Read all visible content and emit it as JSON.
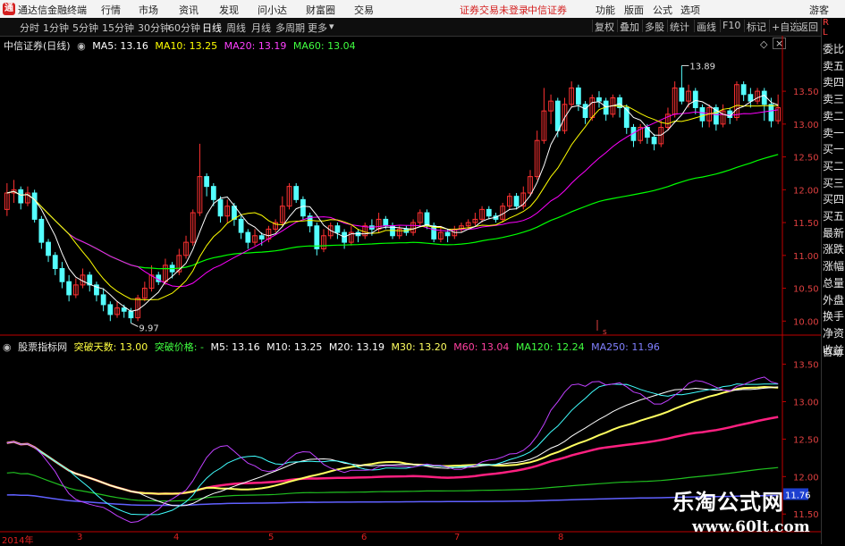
{
  "titlebar": {
    "logo_glyph": "通",
    "app_name": "通达信金融终端",
    "menus": [
      "行情",
      "市场",
      "资讯",
      "发现",
      "问小达",
      "财富圈",
      "交易"
    ],
    "alerts": [
      "证券交易未登录",
      "中信证券"
    ],
    "right_menus": [
      "功能",
      "版面",
      "公式",
      "选项"
    ],
    "guest": "游客"
  },
  "toolbar": {
    "periods": [
      "分时",
      "1分钟",
      "5分钟",
      "15分钟",
      "30分钟",
      "60分钟",
      "日线",
      "周线",
      "月线",
      "多周期",
      "更多"
    ],
    "active_period": "日线",
    "right_buttons": [
      "复权",
      "叠加",
      "多股",
      "统计",
      "画线",
      "F10",
      "标记",
      "+自选",
      "返回"
    ]
  },
  "main_info": {
    "stock": "中信证券(日线)",
    "ma5": "MA5: 13.16",
    "ma10": "MA10: 13.25",
    "ma20": "MA20: 13.19",
    "ma60": "MA60: 13.04"
  },
  "indicator_info": {
    "name": "股票指标网",
    "days": "突破天数: 13.00",
    "price": "突破价格: -",
    "m5": "M5: 13.16",
    "m10": "M10: 13.25",
    "m20": "M20: 13.19",
    "m30": "M30: 13.20",
    "m60": "M60: 13.04",
    "ma120": "MA120: 12.24",
    "ma250": "MA250: 11.96"
  },
  "right_column": {
    "top_label": "R",
    "top_label2": "L",
    "items": [
      "委比",
      "卖五",
      "卖四",
      "卖三",
      "卖二",
      "卖一",
      "买一",
      "买二",
      "买三",
      "买四",
      "买五",
      "最新",
      "涨跌",
      "涨幅",
      "总量",
      "外盘",
      "换手",
      "净资",
      "收益"
    ],
    "bottom": "自动"
  },
  "main_axis": {
    "ticks": [
      "13.50",
      "13.00",
      "12.50",
      "12.00",
      "11.50",
      "11.00",
      "10.50",
      "10.00"
    ]
  },
  "indicator_axis": {
    "ticks": [
      "13.50",
      "13.00",
      "12.50",
      "12.00",
      "11.50"
    ],
    "current_value": "11.76"
  },
  "annotations": {
    "high": "13.89",
    "low": "9.97",
    "marker_s": "s"
  },
  "date_axis": {
    "labels": [
      "2014年",
      "3",
      "4",
      "5",
      "6",
      "7",
      "8"
    ]
  },
  "watermark": {
    "title": "乐淘公式网",
    "url": "www.60lt.com"
  },
  "colors": {
    "up": "#ff3232",
    "down": "#54ffff",
    "ma5": "#ffffff",
    "ma10": "#ffff00",
    "ma20": "#ff00ff",
    "ma60": "#00ff00",
    "axis": "#c00000"
  },
  "chart_data": {
    "type": "candlestick",
    "title": "中信证券(日线)",
    "y_range": [
      9.8,
      14.1
    ],
    "candles": [
      [
        11.7,
        11.95,
        12.1,
        11.6
      ],
      [
        11.95,
        12.0,
        12.15,
        11.8
      ],
      [
        12.0,
        11.8,
        12.05,
        11.7
      ],
      [
        11.8,
        11.95,
        12.05,
        11.75
      ],
      [
        11.95,
        11.55,
        12.0,
        11.5
      ],
      [
        11.55,
        11.2,
        11.6,
        11.1
      ],
      [
        11.2,
        11.0,
        11.25,
        10.9
      ],
      [
        11.0,
        10.8,
        11.05,
        10.7
      ],
      [
        10.8,
        10.6,
        10.9,
        10.5
      ],
      [
        10.6,
        10.4,
        10.7,
        10.3
      ],
      [
        10.4,
        10.55,
        10.65,
        10.35
      ],
      [
        10.55,
        10.7,
        10.8,
        10.5
      ],
      [
        10.7,
        10.55,
        10.75,
        10.45
      ],
      [
        10.55,
        10.4,
        10.6,
        10.3
      ],
      [
        10.4,
        10.25,
        10.5,
        10.15
      ],
      [
        10.25,
        10.1,
        10.3,
        10.0
      ],
      [
        10.1,
        10.2,
        10.3,
        10.05
      ],
      [
        10.2,
        10.15,
        10.25,
        10.05
      ],
      [
        10.15,
        10.05,
        10.2,
        9.97
      ],
      [
        10.05,
        10.35,
        10.4,
        10.0
      ],
      [
        10.35,
        10.5,
        10.6,
        10.3
      ],
      [
        10.5,
        10.7,
        10.85,
        10.45
      ],
      [
        10.7,
        10.6,
        10.75,
        10.55
      ],
      [
        10.6,
        10.85,
        10.95,
        10.55
      ],
      [
        10.85,
        10.75,
        10.9,
        10.65
      ],
      [
        10.75,
        11.0,
        11.1,
        10.7
      ],
      [
        11.0,
        11.2,
        11.3,
        10.95
      ],
      [
        11.2,
        11.65,
        11.7,
        11.15
      ],
      [
        11.65,
        12.2,
        12.7,
        11.6
      ],
      [
        12.2,
        12.05,
        12.25,
        11.9
      ],
      [
        12.05,
        11.85,
        12.1,
        11.75
      ],
      [
        11.85,
        11.6,
        11.9,
        11.5
      ],
      [
        11.6,
        11.75,
        11.85,
        11.5
      ],
      [
        11.75,
        11.55,
        11.8,
        11.45
      ],
      [
        11.55,
        11.35,
        11.6,
        11.25
      ],
      [
        11.35,
        11.2,
        11.4,
        11.1
      ],
      [
        11.2,
        11.3,
        11.4,
        11.15
      ],
      [
        11.3,
        11.25,
        11.35,
        11.15
      ],
      [
        11.25,
        11.4,
        11.45,
        11.2
      ],
      [
        11.4,
        11.5,
        11.55,
        11.35
      ],
      [
        11.5,
        11.75,
        11.9,
        11.45
      ],
      [
        11.75,
        12.05,
        12.1,
        11.7
      ],
      [
        12.05,
        11.85,
        12.1,
        11.8
      ],
      [
        11.85,
        11.6,
        11.9,
        11.55
      ],
      [
        11.6,
        11.45,
        11.65,
        11.35
      ],
      [
        11.45,
        11.1,
        11.5,
        11.0
      ],
      [
        11.1,
        11.3,
        11.4,
        11.05
      ],
      [
        11.3,
        11.45,
        11.5,
        11.25
      ],
      [
        11.45,
        11.35,
        11.5,
        11.25
      ],
      [
        11.35,
        11.2,
        11.4,
        11.1
      ],
      [
        11.2,
        11.35,
        11.45,
        11.15
      ],
      [
        11.35,
        11.3,
        11.4,
        11.2
      ],
      [
        11.3,
        11.45,
        11.5,
        11.25
      ],
      [
        11.45,
        11.4,
        11.55,
        11.3
      ],
      [
        11.4,
        11.55,
        11.65,
        11.35
      ],
      [
        11.55,
        11.45,
        11.6,
        11.4
      ],
      [
        11.45,
        11.3,
        11.5,
        11.25
      ],
      [
        11.3,
        11.4,
        11.45,
        11.25
      ],
      [
        11.4,
        11.35,
        11.45,
        11.3
      ],
      [
        11.35,
        11.5,
        11.55,
        11.3
      ],
      [
        11.5,
        11.65,
        11.7,
        11.45
      ],
      [
        11.65,
        11.45,
        11.7,
        11.4
      ],
      [
        11.45,
        11.25,
        11.5,
        11.2
      ],
      [
        11.25,
        11.35,
        11.45,
        11.2
      ],
      [
        11.35,
        11.3,
        11.4,
        11.2
      ],
      [
        11.3,
        11.4,
        11.45,
        11.25
      ],
      [
        11.4,
        11.45,
        11.5,
        11.35
      ],
      [
        11.45,
        11.5,
        11.55,
        11.4
      ],
      [
        11.5,
        11.55,
        11.65,
        11.45
      ],
      [
        11.55,
        11.7,
        11.75,
        11.5
      ],
      [
        11.7,
        11.6,
        11.75,
        11.55
      ],
      [
        11.6,
        11.55,
        11.65,
        11.5
      ],
      [
        11.55,
        11.75,
        11.8,
        11.5
      ],
      [
        11.75,
        11.9,
        11.95,
        11.7
      ],
      [
        11.9,
        11.75,
        11.95,
        11.7
      ],
      [
        11.75,
        11.95,
        12.05,
        11.7
      ],
      [
        11.95,
        12.2,
        12.3,
        11.9
      ],
      [
        12.2,
        12.75,
        12.9,
        12.15
      ],
      [
        12.75,
        13.2,
        13.55,
        12.7
      ],
      [
        13.2,
        13.35,
        13.45,
        13.0
      ],
      [
        13.35,
        12.9,
        13.4,
        12.8
      ],
      [
        12.9,
        13.3,
        13.4,
        12.85
      ],
      [
        13.3,
        13.55,
        13.65,
        13.25
      ],
      [
        13.55,
        13.3,
        13.6,
        13.2
      ],
      [
        13.3,
        13.1,
        13.35,
        13.0
      ],
      [
        13.1,
        13.4,
        13.45,
        13.05
      ],
      [
        13.4,
        13.35,
        13.5,
        13.25
      ],
      [
        13.35,
        13.15,
        13.4,
        13.05
      ],
      [
        13.15,
        13.4,
        13.45,
        13.1
      ],
      [
        13.4,
        13.25,
        13.45,
        13.1
      ],
      [
        13.25,
        12.95,
        13.3,
        12.85
      ],
      [
        12.95,
        12.75,
        13.0,
        12.65
      ],
      [
        12.75,
        12.95,
        13.0,
        12.7
      ],
      [
        12.95,
        12.8,
        13.0,
        12.7
      ],
      [
        12.8,
        12.7,
        12.85,
        12.6
      ],
      [
        12.7,
        12.95,
        13.05,
        12.65
      ],
      [
        12.95,
        13.15,
        13.25,
        12.9
      ],
      [
        13.15,
        13.55,
        13.65,
        13.1
      ],
      [
        13.55,
        13.35,
        13.89,
        13.3
      ],
      [
        13.35,
        13.5,
        13.6,
        13.25
      ],
      [
        13.5,
        13.25,
        13.55,
        13.15
      ],
      [
        13.25,
        13.05,
        13.3,
        12.95
      ],
      [
        13.05,
        13.25,
        13.3,
        12.95
      ],
      [
        13.25,
        13.0,
        13.3,
        12.9
      ],
      [
        13.0,
        13.2,
        13.3,
        12.95
      ],
      [
        13.2,
        13.1,
        13.25,
        13.0
      ],
      [
        13.1,
        13.6,
        13.65,
        13.05
      ],
      [
        13.6,
        13.45,
        13.65,
        13.35
      ],
      [
        13.45,
        13.35,
        13.55,
        13.25
      ],
      [
        13.35,
        13.5,
        13.55,
        13.3
      ],
      [
        13.5,
        13.3,
        13.55,
        13.05
      ],
      [
        13.3,
        13.05,
        13.4,
        12.95
      ],
      [
        13.05,
        13.25,
        13.45,
        13.0
      ]
    ],
    "indicator_y_range": [
      11.3,
      13.65
    ]
  }
}
